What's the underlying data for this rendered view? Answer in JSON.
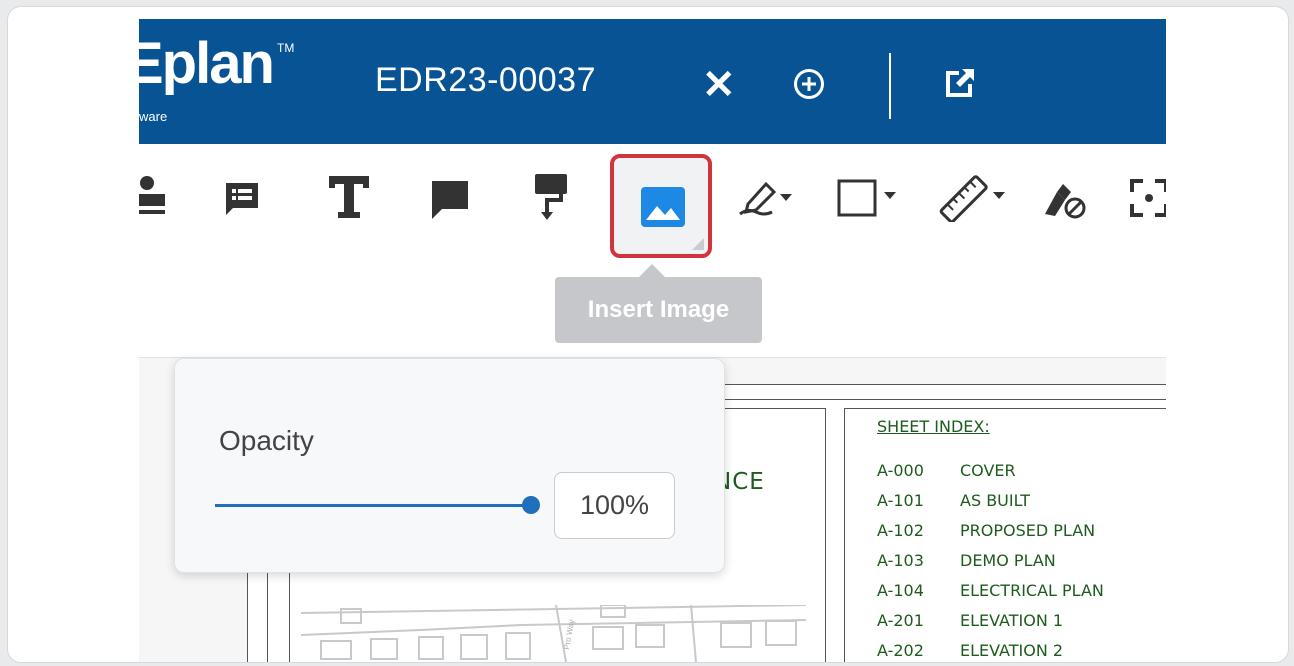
{
  "header": {
    "logo_text": "Eplan",
    "logo_tm": "TM",
    "logo_subtitle": "ware",
    "document_id": "EDR23-00037",
    "close_icon": "close-icon",
    "add_icon": "add-circle-icon",
    "open_external_icon": "open-in-new-icon",
    "background_color": "#075394"
  },
  "toolbar": {
    "tools": [
      {
        "name": "stamp-tool",
        "icon": "stamp-icon"
      },
      {
        "name": "note-tool",
        "icon": "note-list-icon"
      },
      {
        "name": "text-tool",
        "icon": "text-icon"
      },
      {
        "name": "callout-tool",
        "icon": "speech-bubble-icon"
      },
      {
        "name": "format-tool",
        "icon": "paint-roller-icon"
      },
      {
        "name": "insert-image-tool",
        "icon": "image-icon"
      },
      {
        "name": "pen-tool",
        "icon": "pen-icon"
      },
      {
        "name": "shape-tool",
        "icon": "rectangle-icon"
      },
      {
        "name": "measure-tool",
        "icon": "ruler-icon"
      },
      {
        "name": "eraser-tool",
        "icon": "eraser-icon"
      },
      {
        "name": "focus-tool",
        "icon": "focus-icon"
      }
    ],
    "highlight_color": "#d0343c",
    "tooltip": "Insert Image"
  },
  "opacity_panel": {
    "label": "Opacity",
    "value": "100%",
    "level": 1.0,
    "accent_color": "#1f6fbd"
  },
  "drawing": {
    "title_fragment": "NCE",
    "index_title": "SHEET INDEX:",
    "index": [
      {
        "code": "A-000",
        "name": "COVER"
      },
      {
        "code": "A-101",
        "name": "AS BUILT"
      },
      {
        "code": "A-102",
        "name": "PROPOSED PLAN"
      },
      {
        "code": "A-103",
        "name": "DEMO PLAN"
      },
      {
        "code": "A-104",
        "name": "ELECTRICAL PLAN"
      },
      {
        "code": "A-201",
        "name": "ELEVATION 1"
      },
      {
        "code": "A-202",
        "name": "ELEVATION 2"
      }
    ],
    "map_street_label": "Pro Way"
  }
}
